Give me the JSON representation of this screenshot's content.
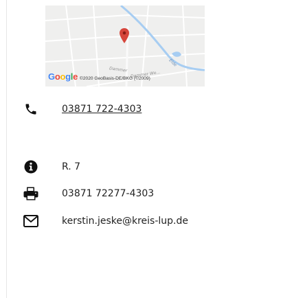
{
  "map": {
    "google_logo_letters": [
      "G",
      "o",
      "o",
      "g",
      "l",
      "e"
    ],
    "google_logo_colors": [
      "#4285F4",
      "#EA4335",
      "#FBBC05",
      "#4285F4",
      "#34A853",
      "#EA4335"
    ],
    "copyright": "©2020 GeoBasis-DE/BKG (©2009)",
    "streets": [
      "Dammer",
      "Dammer We...",
      "Elde"
    ],
    "pin_color": "#d6453b",
    "river_color": "#a7cdf2"
  },
  "contact": {
    "phone": "03871 722-4303",
    "room": "R. 7",
    "fax": "03871 72277-4303",
    "email": "kerstin.jeske@kreis-lup.de"
  },
  "icons": {
    "phone": "phone-icon",
    "info": "info-icon",
    "fax": "printer-icon",
    "email": "envelope-icon"
  }
}
